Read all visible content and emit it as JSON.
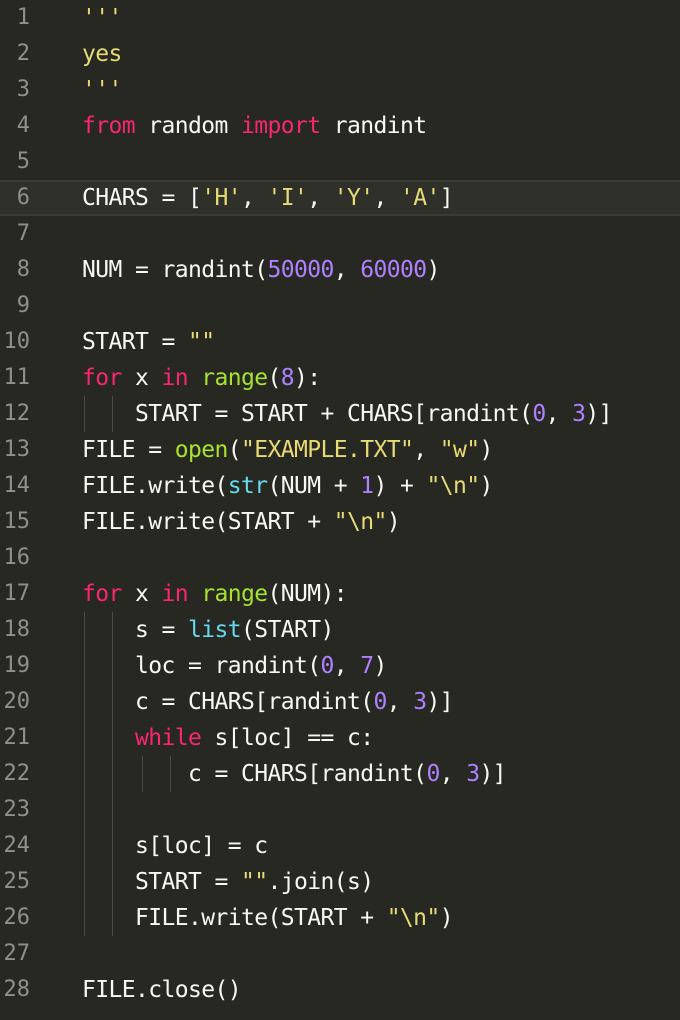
{
  "editor": {
    "lines": [
      {
        "n": "1",
        "tokens": [
          {
            "t": "'''",
            "c": "str"
          }
        ]
      },
      {
        "n": "2",
        "tokens": [
          {
            "t": "yes",
            "c": "str"
          }
        ]
      },
      {
        "n": "3",
        "tokens": [
          {
            "t": "'''",
            "c": "str"
          }
        ]
      },
      {
        "n": "4",
        "tokens": [
          {
            "t": "from",
            "c": "kw"
          },
          {
            "t": " random ",
            "c": ""
          },
          {
            "t": "import",
            "c": "kw"
          },
          {
            "t": " randint",
            "c": ""
          }
        ]
      },
      {
        "n": "5",
        "tokens": []
      },
      {
        "n": "6",
        "tokens": [
          {
            "t": "CHARS = [",
            "c": ""
          },
          {
            "t": "'H'",
            "c": "str"
          },
          {
            "t": ", ",
            "c": ""
          },
          {
            "t": "'I'",
            "c": "str"
          },
          {
            "t": ", ",
            "c": ""
          },
          {
            "t": "'Y'",
            "c": "str"
          },
          {
            "t": ", ",
            "c": ""
          },
          {
            "t": "'A'",
            "c": "str"
          },
          {
            "t": "]",
            "c": ""
          }
        ]
      },
      {
        "n": "7",
        "tokens": []
      },
      {
        "n": "8",
        "tokens": [
          {
            "t": "NUM = randint(",
            "c": ""
          },
          {
            "t": "50000",
            "c": "num"
          },
          {
            "t": ", ",
            "c": ""
          },
          {
            "t": "60000",
            "c": "num"
          },
          {
            "t": ")",
            "c": ""
          }
        ]
      },
      {
        "n": "9",
        "tokens": []
      },
      {
        "n": "10",
        "tokens": [
          {
            "t": "START = ",
            "c": ""
          },
          {
            "t": "\"\"",
            "c": "str"
          }
        ]
      },
      {
        "n": "11",
        "tokens": [
          {
            "t": "for",
            "c": "kw"
          },
          {
            "t": " x ",
            "c": ""
          },
          {
            "t": "in",
            "c": "kw"
          },
          {
            "t": " ",
            "c": ""
          },
          {
            "t": "range",
            "c": "fn"
          },
          {
            "t": "(",
            "c": ""
          },
          {
            "t": "8",
            "c": "num"
          },
          {
            "t": "):",
            "c": ""
          }
        ]
      },
      {
        "n": "12",
        "tokens": [
          {
            "t": "    START = START + CHARS[randint(",
            "c": ""
          },
          {
            "t": "0",
            "c": "num"
          },
          {
            "t": ", ",
            "c": ""
          },
          {
            "t": "3",
            "c": "num"
          },
          {
            "t": ")]",
            "c": ""
          }
        ]
      },
      {
        "n": "13",
        "tokens": [
          {
            "t": "FILE = ",
            "c": ""
          },
          {
            "t": "open",
            "c": "fn"
          },
          {
            "t": "(",
            "c": ""
          },
          {
            "t": "\"EXAMPLE.TXT\"",
            "c": "str"
          },
          {
            "t": ", ",
            "c": ""
          },
          {
            "t": "\"w\"",
            "c": "str"
          },
          {
            "t": ")",
            "c": ""
          }
        ]
      },
      {
        "n": "14",
        "tokens": [
          {
            "t": "FILE.write(",
            "c": ""
          },
          {
            "t": "str",
            "c": "blue"
          },
          {
            "t": "(NUM + ",
            "c": ""
          },
          {
            "t": "1",
            "c": "num"
          },
          {
            "t": ") + ",
            "c": ""
          },
          {
            "t": "\"\\n\"",
            "c": "str"
          },
          {
            "t": ")",
            "c": ""
          }
        ]
      },
      {
        "n": "15",
        "tokens": [
          {
            "t": "FILE.write(START + ",
            "c": ""
          },
          {
            "t": "\"\\n\"",
            "c": "str"
          },
          {
            "t": ")",
            "c": ""
          }
        ]
      },
      {
        "n": "16",
        "tokens": []
      },
      {
        "n": "17",
        "tokens": [
          {
            "t": "for",
            "c": "kw"
          },
          {
            "t": " x ",
            "c": ""
          },
          {
            "t": "in",
            "c": "kw"
          },
          {
            "t": " ",
            "c": ""
          },
          {
            "t": "range",
            "c": "fn"
          },
          {
            "t": "(NUM):",
            "c": ""
          }
        ]
      },
      {
        "n": "18",
        "tokens": [
          {
            "t": "    s = ",
            "c": ""
          },
          {
            "t": "list",
            "c": "blue"
          },
          {
            "t": "(START)",
            "c": ""
          }
        ]
      },
      {
        "n": "19",
        "tokens": [
          {
            "t": "    loc = randint(",
            "c": ""
          },
          {
            "t": "0",
            "c": "num"
          },
          {
            "t": ", ",
            "c": ""
          },
          {
            "t": "7",
            "c": "num"
          },
          {
            "t": ")",
            "c": ""
          }
        ]
      },
      {
        "n": "20",
        "tokens": [
          {
            "t": "    c = CHARS[randint(",
            "c": ""
          },
          {
            "t": "0",
            "c": "num"
          },
          {
            "t": ", ",
            "c": ""
          },
          {
            "t": "3",
            "c": "num"
          },
          {
            "t": ")]",
            "c": ""
          }
        ]
      },
      {
        "n": "21",
        "tokens": [
          {
            "t": "    ",
            "c": ""
          },
          {
            "t": "while",
            "c": "kw"
          },
          {
            "t": " s[loc] == c:",
            "c": ""
          }
        ]
      },
      {
        "n": "22",
        "tokens": [
          {
            "t": "        c = CHARS[randint(",
            "c": ""
          },
          {
            "t": "0",
            "c": "num"
          },
          {
            "t": ", ",
            "c": ""
          },
          {
            "t": "3",
            "c": "num"
          },
          {
            "t": ")]",
            "c": ""
          }
        ]
      },
      {
        "n": "23",
        "tokens": []
      },
      {
        "n": "24",
        "tokens": [
          {
            "t": "    s[loc] = c",
            "c": ""
          }
        ]
      },
      {
        "n": "25",
        "tokens": [
          {
            "t": "    START = ",
            "c": ""
          },
          {
            "t": "\"\"",
            "c": "str"
          },
          {
            "t": ".join(s)",
            "c": ""
          }
        ]
      },
      {
        "n": "26",
        "tokens": [
          {
            "t": "    FILE.write(START + ",
            "c": ""
          },
          {
            "t": "\"\\n\"",
            "c": "str"
          },
          {
            "t": ")",
            "c": ""
          }
        ]
      },
      {
        "n": "27",
        "tokens": []
      },
      {
        "n": "28",
        "tokens": [
          {
            "t": "FILE.close()",
            "c": ""
          }
        ]
      }
    ],
    "current_line": "6",
    "colors": {
      "background": "#272822",
      "foreground": "#f8f8f2",
      "keyword": "#f92672",
      "function": "#a6e22e",
      "builtin": "#66d9ef",
      "string": "#e6db74",
      "number": "#ae81ff",
      "line_number": "#8f908a"
    }
  }
}
